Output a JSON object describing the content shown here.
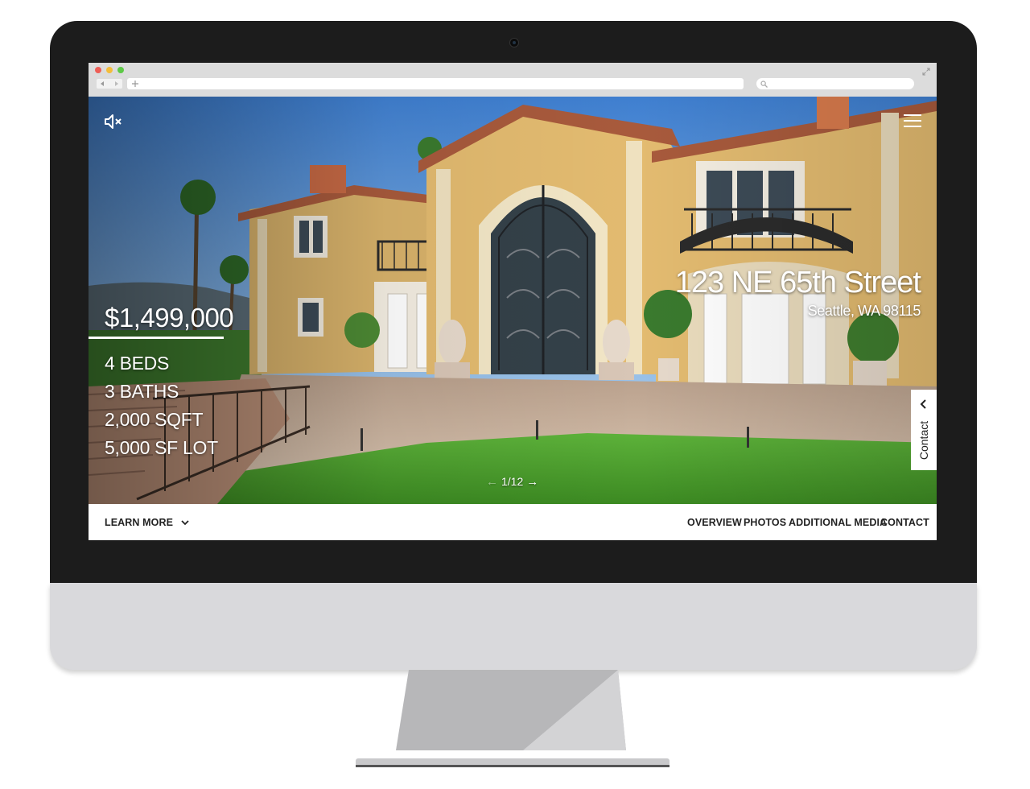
{
  "listing": {
    "price": "$1,499,000",
    "stats": [
      "4 BEDS",
      "3 BATHS",
      "2,000 SQFT",
      "5,000 SF LOT"
    ],
    "address": "123 NE 65th Street",
    "city": "Seattle, WA 98115"
  },
  "slideshow": {
    "counter": "1/12",
    "prev_icon": "arrow-left-icon",
    "next_icon": "arrow-right-icon"
  },
  "controls": {
    "mute_icon": "speaker-muted-icon",
    "menu_icon": "hamburger-menu-icon"
  },
  "contact_tab": {
    "label": "Contact",
    "icon": "chevron-left-icon"
  },
  "nav": {
    "learn_more": "LEARN MORE",
    "learn_more_icon": "chevron-down-icon",
    "links": [
      "OVERVIEW",
      "PHOTOS",
      "ADDITIONAL MEDIA",
      "CONTACT"
    ]
  },
  "colors": {
    "bezel": "#1c1c1c",
    "chin": "#d9d9dc",
    "nav_background": "#ffffff",
    "nav_text": "#222222"
  }
}
